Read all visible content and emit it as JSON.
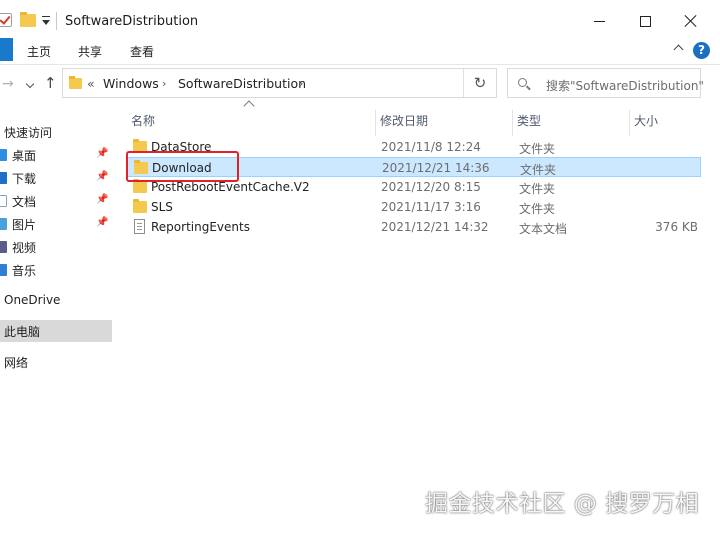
{
  "window": {
    "title": "SoftwareDistribution"
  },
  "ribbon": {
    "tabs": [
      "主页",
      "共享",
      "查看"
    ],
    "help_label": "?"
  },
  "address": {
    "overflow": "«",
    "crumbs": [
      "Windows",
      "SoftwareDistribution"
    ],
    "separator": "›",
    "refresh_glyph": "↻"
  },
  "search": {
    "placeholder": "搜索\"SoftwareDistribution\""
  },
  "nav": {
    "back_glyph": "→",
    "up_glyph": "↑"
  },
  "sidebar": {
    "items": [
      {
        "label": "快速访问",
        "icon": "star-icon",
        "pinned": false
      },
      {
        "label": "桌面",
        "icon": "desktop-icon",
        "pinned": true
      },
      {
        "label": "下载",
        "icon": "download-icon",
        "pinned": true
      },
      {
        "label": "文档",
        "icon": "documents-icon",
        "pinned": true
      },
      {
        "label": "图片",
        "icon": "pictures-icon",
        "pinned": true
      },
      {
        "label": "视频",
        "icon": "videos-icon",
        "pinned": false
      },
      {
        "label": "音乐",
        "icon": "music-icon",
        "pinned": false
      },
      {
        "label": "OneDrive",
        "icon": "onedrive-icon",
        "pinned": false
      },
      {
        "label": "此电脑",
        "icon": "this-pc-icon",
        "pinned": false,
        "selected": true
      },
      {
        "label": "网络",
        "icon": "network-icon",
        "pinned": false
      }
    ],
    "pin_glyph": "📌"
  },
  "table": {
    "columns": [
      "名称",
      "修改日期",
      "类型",
      "大小"
    ],
    "rows": [
      {
        "name": "DataStore",
        "date": "2021/11/8 12:24",
        "type": "文件夹",
        "size": "",
        "kind": "folder"
      },
      {
        "name": "Download",
        "date": "2021/12/21 14:36",
        "type": "文件夹",
        "size": "",
        "kind": "folder",
        "selected": true
      },
      {
        "name": "PostRebootEventCache.V2",
        "date": "2021/12/20 8:15",
        "type": "文件夹",
        "size": "",
        "kind": "folder"
      },
      {
        "name": "SLS",
        "date": "2021/11/17 3:16",
        "type": "文件夹",
        "size": "",
        "kind": "folder"
      },
      {
        "name": "ReportingEvents",
        "date": "2021/12/21 14:32",
        "type": "文本文档",
        "size": "376 KB",
        "kind": "file"
      }
    ]
  },
  "watermark": "掘金技术社区 @ 搜罗万相",
  "colors": {
    "accent": "#1979ca",
    "selection_fill": "#cce8ff",
    "selection_border": "#99d1ff",
    "annotation_red": "#e0232a",
    "folder_yellow": "#f4c94d"
  }
}
